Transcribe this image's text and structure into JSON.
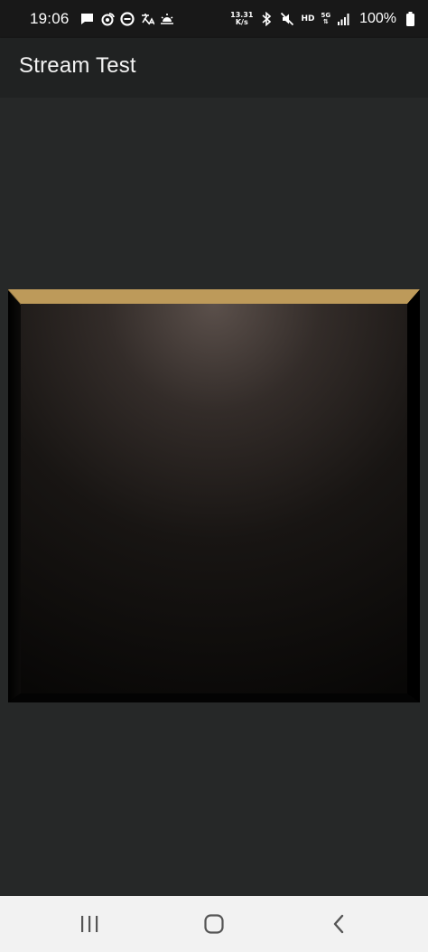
{
  "status_bar": {
    "time": "19:06",
    "net_speed_value": "13.31",
    "net_speed_unit": "K/s",
    "hd_label": "HD",
    "network_label": "5G",
    "battery_percent": "100%",
    "left_icons": [
      "message-icon",
      "weibo-icon",
      "e-app-icon",
      "translate-icon",
      "weather-icon"
    ],
    "right_icons": [
      "bluetooth-icon",
      "mute-icon",
      "signal-icon",
      "battery-icon"
    ]
  },
  "app_bar": {
    "title": "Stream Test"
  },
  "stage": {
    "bevel_top_color": "#bd9a5a",
    "frame_color": "#000000",
    "glow_color": "#5b504b",
    "inner_dark_color": "#080706"
  },
  "nav_bar": {
    "buttons": [
      "recent-apps",
      "home",
      "back"
    ]
  },
  "colors": {
    "background": "#262828",
    "app_bar": "#202222",
    "status_bar": "#181818",
    "nav_bar": "#f2f2f2",
    "nav_icon": "#555555"
  }
}
